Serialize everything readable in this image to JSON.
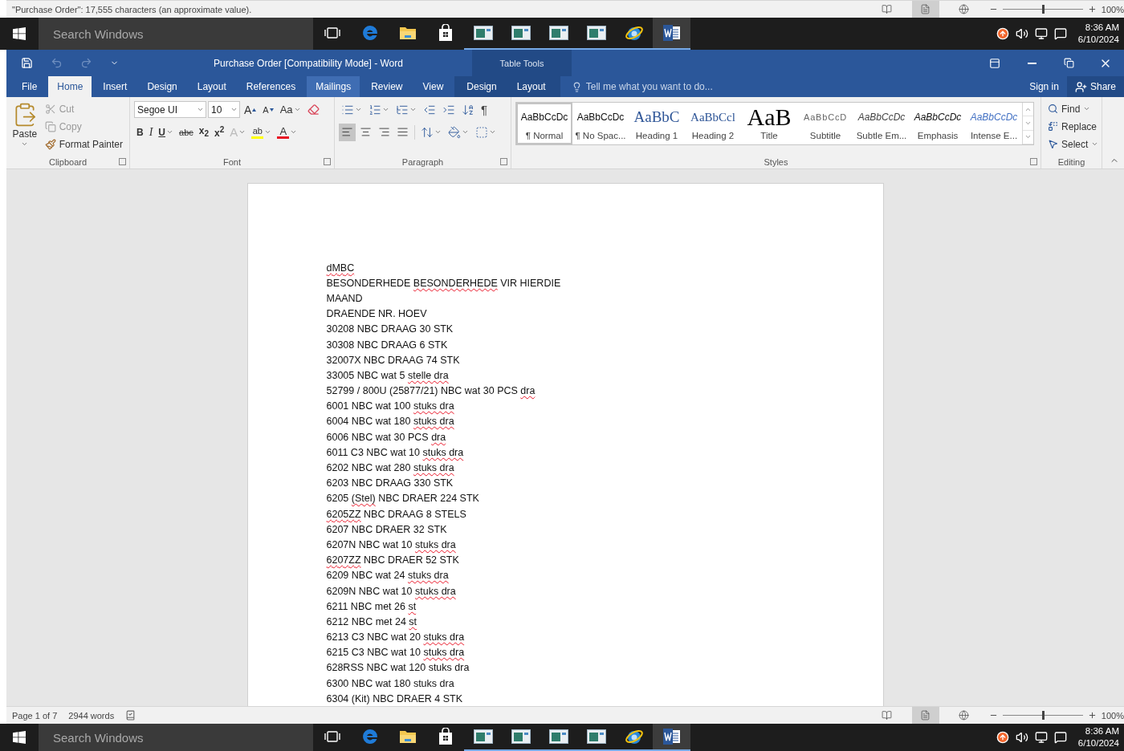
{
  "background_status_bar": {
    "text": "\"Purchase Order\": 17,555 characters (an approximate value).",
    "views": [
      {
        "kind": "read",
        "selected": false
      },
      {
        "kind": "print",
        "selected": true
      },
      {
        "kind": "web",
        "selected": false
      }
    ],
    "zoom": {
      "level": 0.5,
      "reading": "100%"
    }
  },
  "top_taskbar": {
    "search": {
      "placeholder": "Search Windows"
    },
    "apps": [
      {
        "kind": "taskview",
        "selected": false,
        "running": false
      },
      {
        "kind": "edge",
        "selected": false,
        "running": false
      },
      {
        "kind": "explorer",
        "selected": false,
        "running": false
      },
      {
        "kind": "store",
        "selected": false,
        "running": false
      },
      {
        "kind": "window",
        "selected": false,
        "running": true
      },
      {
        "kind": "window",
        "selected": false,
        "running": true
      },
      {
        "kind": "window",
        "selected": false,
        "running": true
      },
      {
        "kind": "window",
        "selected": false,
        "running": true
      },
      {
        "kind": "ie",
        "selected": false,
        "running": true
      },
      {
        "kind": "word",
        "selected": true,
        "running": true
      }
    ],
    "time": "8:36 AM",
    "date": "6/10/2024"
  },
  "window": {
    "quick_access": [
      {
        "kind": "save",
        "disabled": false
      },
      {
        "kind": "undo",
        "disabled": true
      },
      {
        "kind": "redo",
        "disabled": true
      },
      {
        "kind": "customize",
        "disabled": false
      }
    ],
    "title": "Purchase Order [Compatibility Mode] - Word",
    "context_label": "Table Tools",
    "tabs": [
      {
        "label": "File",
        "selected": false,
        "hovered": false,
        "contextual": false
      },
      {
        "label": "Home",
        "selected": true,
        "hovered": false,
        "contextual": false
      },
      {
        "label": "Insert",
        "selected": false,
        "hovered": false,
        "contextual": false
      },
      {
        "label": "Design",
        "selected": false,
        "hovered": false,
        "contextual": false
      },
      {
        "label": "Layout",
        "selected": false,
        "hovered": false,
        "contextual": false
      },
      {
        "label": "References",
        "selected": false,
        "hovered": false,
        "contextual": false
      },
      {
        "label": "Mailings",
        "selected": false,
        "hovered": true,
        "contextual": false
      },
      {
        "label": "Review",
        "selected": false,
        "hovered": false,
        "contextual": false
      },
      {
        "label": "View",
        "selected": false,
        "hovered": false,
        "contextual": false
      },
      {
        "label": "Design",
        "selected": false,
        "hovered": false,
        "contextual": true
      },
      {
        "label": "Layout",
        "selected": false,
        "hovered": false,
        "contextual": true
      }
    ],
    "tell_me": {
      "placeholder": "Tell me what you want to do..."
    },
    "sign_in": "Sign in",
    "share": "Share"
  },
  "ribbon": {
    "clipboard": {
      "label": "Clipboard",
      "paste": "Paste",
      "commands": [
        {
          "kind": "cut",
          "label": "Cut",
          "disabled": true
        },
        {
          "kind": "copy",
          "label": "Copy",
          "disabled": true
        },
        {
          "kind": "format-painter",
          "label": "Format Painter",
          "disabled": false
        }
      ]
    },
    "font": {
      "label": "Font",
      "font_name": "Segoe UI",
      "font_size": "10",
      "row1": [
        {
          "kind": "grow",
          "label": "A"
        },
        {
          "kind": "shrink",
          "label": "A"
        },
        {
          "kind": "case",
          "label": "Aa"
        },
        {
          "kind": "clear"
        }
      ],
      "row2": [
        {
          "kind": "bold",
          "label": "B"
        },
        {
          "kind": "italic",
          "label": "I"
        },
        {
          "kind": "underline",
          "label": "U"
        },
        {
          "kind": "strike",
          "label": "abc"
        },
        {
          "kind": "subscript",
          "label": "x$_{2}$"
        },
        {
          "kind": "superscript",
          "label": "x$^{2}$"
        },
        {
          "kind": "effects",
          "label": "A"
        },
        {
          "kind": "highlight",
          "label": "ab"
        },
        {
          "kind": "color",
          "label": "A"
        }
      ]
    },
    "paragraph": {
      "label": "Paragraph",
      "row1": [
        {
          "kind": "bullets"
        },
        {
          "kind": "numbering"
        },
        {
          "kind": "multilevel"
        },
        {
          "kind": "outdent"
        },
        {
          "kind": "indent"
        },
        {
          "kind": "sort"
        },
        {
          "kind": "marks",
          "label": "¶"
        }
      ],
      "alignment": [
        {
          "kind": "left",
          "selected": true
        },
        {
          "kind": "center",
          "selected": false
        },
        {
          "kind": "right",
          "selected": false
        },
        {
          "kind": "justify",
          "selected": false
        }
      ],
      "row2": [
        {
          "kind": "spacing"
        },
        {
          "kind": "shading"
        },
        {
          "kind": "borders"
        }
      ]
    },
    "styles": {
      "label": "Styles",
      "items": [
        {
          "preview": "AaBbCcDc",
          "name": "¶ Normal",
          "kind": "normal",
          "selected": true
        },
        {
          "preview": "AaBbCcDc",
          "name": "¶ No Spac...",
          "kind": "normal",
          "selected": false
        },
        {
          "preview": "AaBbC",
          "name": "Heading 1",
          "kind": "heading1",
          "selected": false
        },
        {
          "preview": "AaBbCcl",
          "name": "Heading 2",
          "kind": "heading2",
          "selected": false
        },
        {
          "preview": "AaB",
          "name": "Title",
          "kind": "title",
          "selected": false
        },
        {
          "preview": "AaBbCcD",
          "name": "Subtitle",
          "kind": "subtitle",
          "selected": false
        },
        {
          "preview": "AaBbCcDc",
          "name": "Subtle Em...",
          "kind": "subtle",
          "selected": false
        },
        {
          "preview": "AaBbCcDc",
          "name": "Emphasis",
          "kind": "emphasis",
          "selected": false
        },
        {
          "preview": "AaBbCcDc",
          "name": "Intense E...",
          "kind": "intense",
          "selected": false
        }
      ]
    },
    "editing": {
      "label": "Editing",
      "commands": [
        {
          "kind": "find",
          "label": "Find"
        },
        {
          "kind": "replace",
          "label": "Replace"
        },
        {
          "kind": "select",
          "label": "Select"
        }
      ]
    }
  },
  "document": {
    "lines": [
      {
        "segments": [
          {
            "text": "dMBC",
            "misspelled": true
          }
        ]
      },
      {
        "segments": [
          {
            "text": "BESONDERHEDE ",
            "misspelled": false
          },
          {
            "text": "BESONDERHEDE",
            "misspelled": true
          },
          {
            "text": " VIR HIERDIE",
            "misspelled": false
          }
        ]
      },
      {
        "segments": [
          {
            "text": "MAAND",
            "misspelled": false
          }
        ]
      },
      {
        "segments": [
          {
            "text": "DRAENDE NR. HOEV",
            "misspelled": false
          }
        ]
      },
      {
        "segments": [
          {
            "text": "30208 NBC DRAAG 30 STK",
            "misspelled": false
          }
        ]
      },
      {
        "segments": [
          {
            "text": "30308 NBC DRAAG 6 STK",
            "misspelled": false
          }
        ]
      },
      {
        "segments": [
          {
            "text": "32007X NBC DRAAG 74 STK",
            "misspelled": false
          }
        ]
      },
      {
        "segments": [
          {
            "text": "33005 NBC wat 5 ",
            "misspelled": false
          },
          {
            "text": "stelle dra",
            "misspelled": true
          }
        ]
      },
      {
        "segments": [
          {
            "text": "52799 / 800U (25877/21) NBC wat 30 PCS ",
            "misspelled": false
          },
          {
            "text": "dra",
            "misspelled": true
          }
        ]
      },
      {
        "segments": [
          {
            "text": "6001 NBC wat 100 ",
            "misspelled": false
          },
          {
            "text": "stuks dra",
            "misspelled": true
          }
        ]
      },
      {
        "segments": [
          {
            "text": "6004 NBC wat 180 ",
            "misspelled": false
          },
          {
            "text": "stuks dra",
            "misspelled": true
          }
        ]
      },
      {
        "segments": [
          {
            "text": "6006 NBC wat 30 PCS ",
            "misspelled": false
          },
          {
            "text": "dra",
            "misspelled": true
          }
        ]
      },
      {
        "segments": [
          {
            "text": "6011 C3 NBC wat 10 ",
            "misspelled": false
          },
          {
            "text": "stuks dra",
            "misspelled": true
          }
        ]
      },
      {
        "segments": [
          {
            "text": "6202 NBC wat 280 ",
            "misspelled": false
          },
          {
            "text": "stuks dra",
            "misspelled": true
          }
        ]
      },
      {
        "segments": [
          {
            "text": "6203 NBC DRAAG 330 STK",
            "misspelled": false
          }
        ]
      },
      {
        "segments": [
          {
            "text": "6205 ",
            "misspelled": false
          },
          {
            "text": "(Stel)",
            "misspelled": true
          },
          {
            "text": " NBC DRAER 224 STK",
            "misspelled": false
          }
        ]
      },
      {
        "segments": [
          {
            "text": "6205ZZ",
            "misspelled": true
          },
          {
            "text": " NBC DRAAG 8 STELS",
            "misspelled": false
          }
        ]
      },
      {
        "segments": [
          {
            "text": "6207 NBC DRAER 32 STK",
            "misspelled": false
          }
        ]
      },
      {
        "segments": [
          {
            "text": "6207N NBC wat 10 ",
            "misspelled": false
          },
          {
            "text": "stuks dra",
            "misspelled": true
          }
        ]
      },
      {
        "segments": [
          {
            "text": "6207ZZ",
            "misspelled": true
          },
          {
            "text": " NBC DRAER 52 STK",
            "misspelled": false
          }
        ]
      },
      {
        "segments": [
          {
            "text": "6209 NBC wat 24 ",
            "misspelled": false
          },
          {
            "text": "stuks dra",
            "misspelled": true
          }
        ]
      },
      {
        "segments": [
          {
            "text": "6209N NBC wat 10 ",
            "misspelled": false
          },
          {
            "text": "stuks dra",
            "misspelled": true
          }
        ]
      },
      {
        "segments": [
          {
            "text": "6211 NBC met 26 ",
            "misspelled": false
          },
          {
            "text": "st",
            "misspelled": true
          }
        ]
      },
      {
        "segments": [
          {
            "text": "6212 NBC met 24 ",
            "misspelled": false
          },
          {
            "text": "st",
            "misspelled": true
          }
        ]
      },
      {
        "segments": [
          {
            "text": "6213 C3 NBC wat 20 ",
            "misspelled": false
          },
          {
            "text": "stuks dra",
            "misspelled": true
          }
        ]
      },
      {
        "segments": [
          {
            "text": "6215 C3 NBC wat 10 ",
            "misspelled": false
          },
          {
            "text": "stuks dra",
            "misspelled": true
          }
        ]
      },
      {
        "segments": [
          {
            "text": "628RSS NBC wat 120 stuks dra",
            "misspelled": false
          }
        ]
      },
      {
        "segments": [
          {
            "text": "6300 NBC wat 180 stuks dra",
            "misspelled": false
          }
        ]
      },
      {
        "segments": [
          {
            "text": "6304 (Kit) NBC DRAER 4 STK",
            "misspelled": false
          }
        ]
      }
    ]
  },
  "status_bar": {
    "page": "Page 1 of 7",
    "words": "2944 words",
    "views": [
      {
        "kind": "read",
        "selected": false
      },
      {
        "kind": "print",
        "selected": true
      },
      {
        "kind": "web",
        "selected": false
      }
    ],
    "zoom": {
      "level": 0.5,
      "reading": "100%"
    }
  },
  "bottom_taskbar": {
    "search": {
      "placeholder": "Search Windows"
    },
    "apps": [
      {
        "kind": "taskview",
        "selected": false,
        "running": false
      },
      {
        "kind": "edge",
        "selected": false,
        "running": false
      },
      {
        "kind": "explorer",
        "selected": false,
        "running": false
      },
      {
        "kind": "store",
        "selected": false,
        "running": false
      },
      {
        "kind": "window",
        "selected": false,
        "running": true
      },
      {
        "kind": "window",
        "selected": false,
        "running": true
      },
      {
        "kind": "window",
        "selected": false,
        "running": true
      },
      {
        "kind": "window",
        "selected": false,
        "running": true
      },
      {
        "kind": "ie",
        "selected": false,
        "running": true
      },
      {
        "kind": "word",
        "selected": true,
        "running": true
      }
    ],
    "time": "8:36 AM",
    "date": "6/10/2024"
  }
}
